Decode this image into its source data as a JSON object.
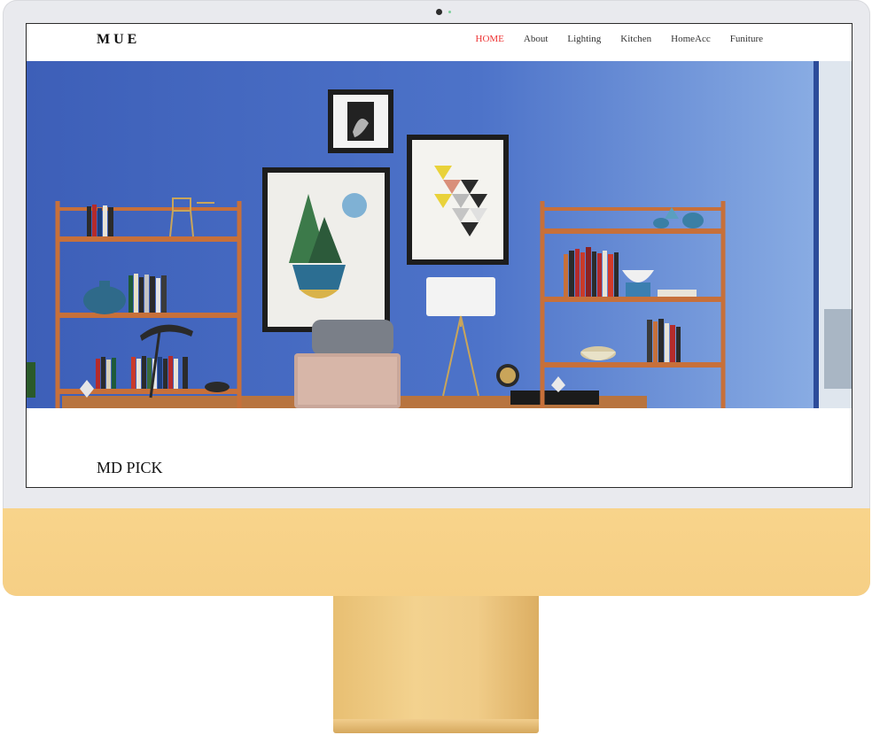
{
  "site": {
    "logo": "MUE"
  },
  "nav": {
    "items": [
      {
        "label": "HOME",
        "active": true
      },
      {
        "label": "About",
        "active": false
      },
      {
        "label": "Lighting",
        "active": false
      },
      {
        "label": "Kitchen",
        "active": false
      },
      {
        "label": "HomeAcc",
        "active": false
      },
      {
        "label": "Funiture",
        "active": false
      }
    ]
  },
  "main": {
    "section_title": "MD PICK"
  },
  "colors": {
    "accent": "#e33333",
    "monitor_chin": "#f8d48b",
    "hero_wall": "#4a6fc4",
    "shelf_wood": "#c7703a"
  }
}
